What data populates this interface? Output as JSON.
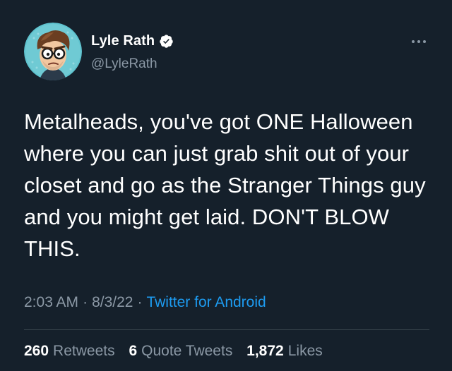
{
  "user": {
    "display_name": "Lyle Rath",
    "handle": "@LyleRath",
    "verified": true,
    "verified_color": "#1d9bf0"
  },
  "tweet": {
    "text": "Metalheads, you've got ONE Halloween where you can just grab shit out of your closet and go as the Stranger Things guy and you might get laid. DON'T BLOW THIS."
  },
  "meta": {
    "time": "2:03 AM",
    "separator": "·",
    "date": "8/3/22",
    "source": "Twitter for Android"
  },
  "stats": {
    "retweets_count": "260",
    "retweets_label": "Retweets",
    "quote_count": "6",
    "quote_label": "Quote Tweets",
    "likes_count": "1,872",
    "likes_label": "Likes"
  },
  "colors": {
    "background": "#15202b",
    "secondary_text": "#8b98a5",
    "link": "#1d9bf0",
    "divider": "#38444d"
  },
  "icons": {
    "more": "more-horizontal-icon",
    "verified": "verified-badge-icon"
  }
}
